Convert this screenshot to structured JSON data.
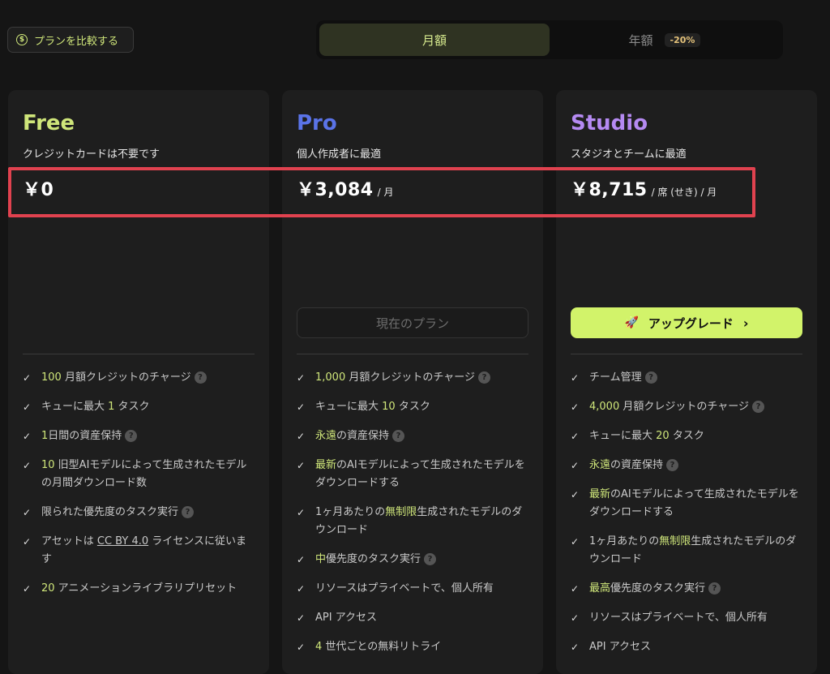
{
  "compare_button": {
    "label": "プランを比較する",
    "icon": "dollar-coin-icon"
  },
  "billing_toggle": {
    "monthly": "月額",
    "yearly": "年額",
    "yearly_badge": "-20%"
  },
  "colors": {
    "free_title": "#cfe67a",
    "pro_title": "#5a73e8",
    "studio_title": "#b58af2",
    "accent": "#d2f36a",
    "highlight_box": "#e0424f"
  },
  "plans": {
    "free": {
      "name": "Free",
      "subtitle": "クレジットカードは不要です",
      "price": "￥0",
      "features": {
        "f0": {
          "a": "100",
          "b": " 月額クレジットのチャージ"
        },
        "f1": {
          "a": "キューに最大 ",
          "b": "1",
          "c": " タスク"
        },
        "f2": {
          "a": "1",
          "b": "日間の資産保持"
        },
        "f3": {
          "a": "10",
          "b": " 旧型AIモデルによって生成されたモデルの月間ダウンロード数"
        },
        "f4": {
          "a": "限られた優先度のタスク実行"
        },
        "f5": {
          "a": "アセットは ",
          "b": "CC BY 4.0",
          "c": " ライセンスに従います"
        },
        "f6": {
          "a": "20",
          "b": " アニメーションライブラリプリセット"
        }
      }
    },
    "pro": {
      "name": "Pro",
      "subtitle": "個人作成者に最適",
      "price": "￥3,084",
      "unit": "/ 月",
      "action": "現在のプラン",
      "features": {
        "f0": {
          "a": "1,000",
          "b": " 月額クレジットのチャージ"
        },
        "f1": {
          "a": "キューに最大 ",
          "b": "10",
          "c": " タスク"
        },
        "f2": {
          "a": "永遠",
          "b": "の資産保持"
        },
        "f3": {
          "a": "最新",
          "b": "のAIモデルによって生成されたモデルをダウンロードする"
        },
        "f4": {
          "a": "1ヶ月あたりの",
          "b": "無制限",
          "c": "生成されたモデルのダウンロード"
        },
        "f5": {
          "a": "中",
          "b": "優先度のタスク実行"
        },
        "f6": {
          "a": "リソースはプライベートで、個人所有"
        },
        "f7": {
          "a": "API アクセス"
        },
        "f8": {
          "a": "4",
          "b": " 世代ごとの無料リトライ"
        }
      }
    },
    "studio": {
      "name": "Studio",
      "subtitle": "スタジオとチームに最適",
      "price": "￥8,715",
      "unit": "/ 席 (せき) / 月",
      "action": "アップグレード",
      "features": {
        "f0": {
          "a": "チーム管理"
        },
        "f1": {
          "a": "4,000",
          "b": " 月額クレジットのチャージ"
        },
        "f2": {
          "a": "キューに最大 ",
          "b": "20",
          "c": " タスク"
        },
        "f3": {
          "a": "永遠",
          "b": "の資産保持"
        },
        "f4": {
          "a": "最新",
          "b": "のAIモデルによって生成されたモデルをダウンロードする"
        },
        "f5": {
          "a": "1ヶ月あたりの",
          "b": "無制限",
          "c": "生成されたモデルのダウンロード"
        },
        "f6": {
          "a": "最高",
          "b": "優先度のタスク実行"
        },
        "f7": {
          "a": "リソースはプライベートで、個人所有"
        },
        "f8": {
          "a": "API アクセス"
        }
      }
    }
  }
}
